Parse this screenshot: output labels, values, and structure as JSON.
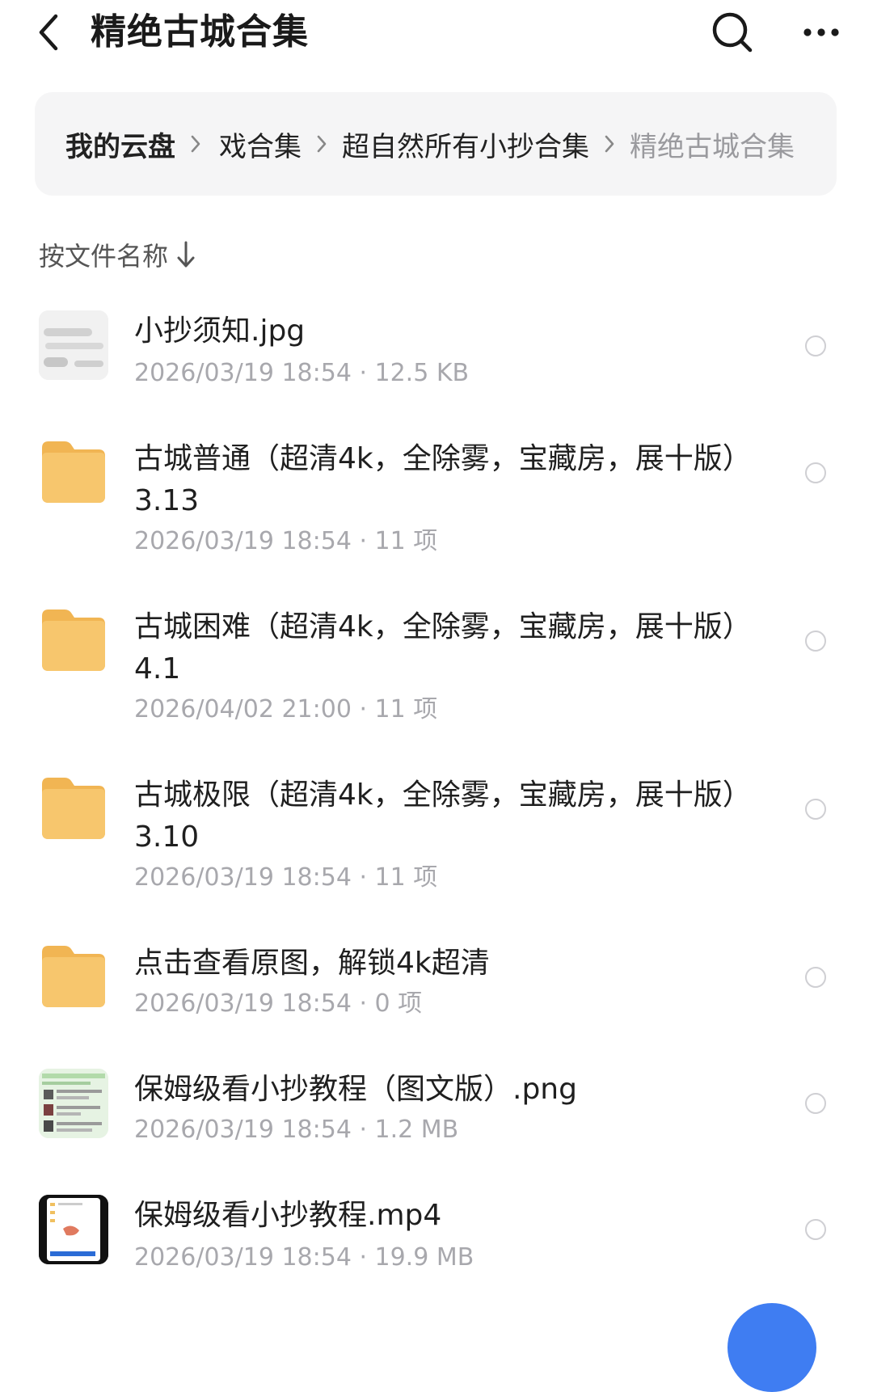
{
  "header": {
    "title": "精绝古城合集",
    "back_icon": "chevron-left-icon",
    "search_icon": "search-icon",
    "more_icon": "more-horizontal-icon"
  },
  "breadcrumb": {
    "items": [
      "我的云盘",
      "戏合集",
      "超自然所有小抄合集",
      "精绝古城合集"
    ],
    "separator_icon": "chevron-right-icon"
  },
  "sort": {
    "label": "按文件名称",
    "arrow_icon": "arrow-down-icon"
  },
  "files": [
    {
      "name": "小抄须知.jpg",
      "meta": "2026/03/19 18:54 · 12.5 KB",
      "type": "image"
    },
    {
      "name": "古城普通（超清4k，全除雾，宝藏房，展十版）3.13",
      "meta": "2026/03/19 18:54 · 11 项",
      "type": "folder"
    },
    {
      "name": "古城困难（超清4k，全除雾，宝藏房，展十版）4.1",
      "meta": "2026/04/02 21:00 · 11 项",
      "type": "folder"
    },
    {
      "name": "古城极限（超清4k，全除雾，宝藏房，展十版）3.10",
      "meta": "2026/03/19 18:54 · 11 项",
      "type": "folder"
    },
    {
      "name": "点击查看原图，解锁4k超清",
      "meta": "2026/03/19 18:54 · 0 项",
      "type": "folder"
    },
    {
      "name": "保姆级看小抄教程（图文版）.png",
      "meta": "2026/03/19 18:54 · 1.2 MB",
      "type": "image"
    },
    {
      "name": "保姆级看小抄教程.mp4",
      "meta": "2026/03/19 18:54 · 19.9 MB",
      "type": "video"
    }
  ],
  "colors": {
    "folder": "#f5c063",
    "accent": "#3f7df2",
    "meta_text": "#a8a8ad",
    "breadcrumb_bg": "#f5f5f6"
  }
}
